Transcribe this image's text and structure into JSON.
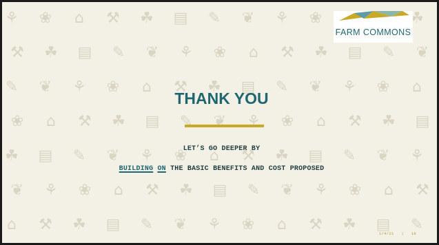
{
  "logo": {
    "text": "FARM COMMONS"
  },
  "slide": {
    "title": "THANK YOU",
    "line1": "LET’S GO DEEPER BY",
    "link1": "BUILDING",
    "link2": "ON",
    "line2_rest": "THE BASIC BENEFITS AND COST PROPOSED"
  },
  "footer": {
    "date": "1/4/21",
    "separator": "|",
    "page": "18"
  },
  "colors": {
    "title": "#1f6671",
    "accent": "#c8a825",
    "background": "#f3f1e6"
  }
}
